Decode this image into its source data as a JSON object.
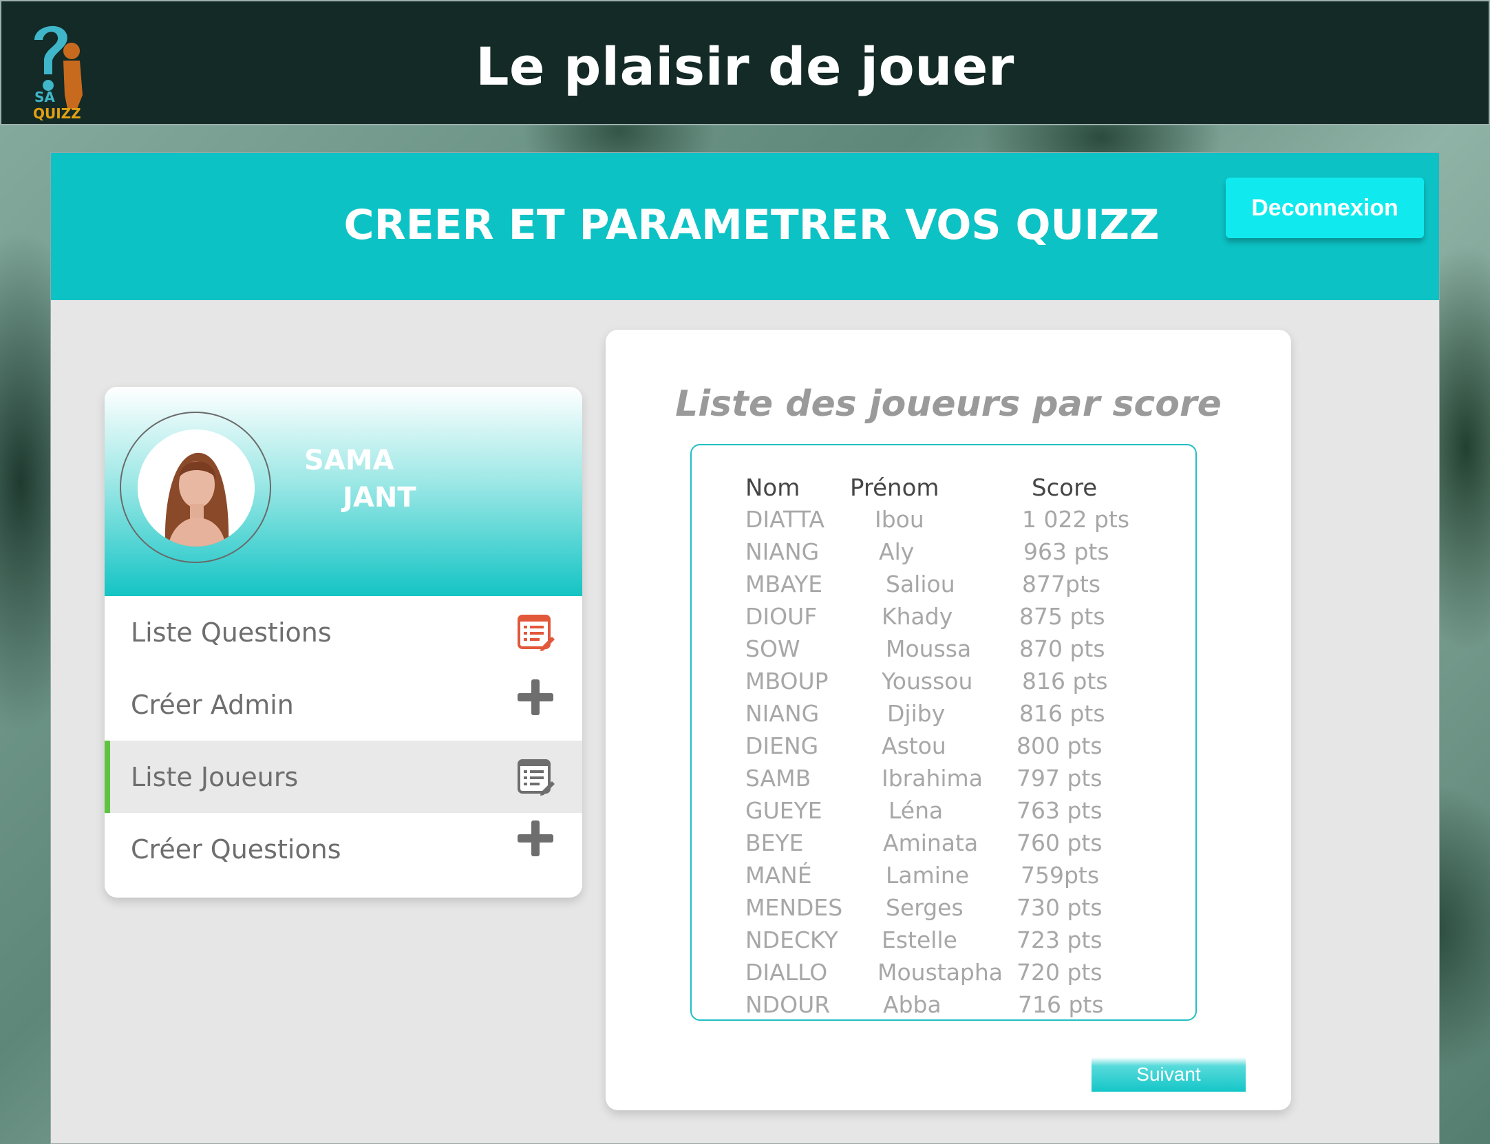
{
  "header": {
    "logo_text_top": "SA",
    "logo_text_bottom": "QUIZZ",
    "title": "Le plaisir de jouer"
  },
  "banner": {
    "title": "CREER ET PARAMETRER VOS QUIZZ",
    "logout_label": "Deconnexion"
  },
  "profile": {
    "first_name": "SAMA",
    "last_name": "JANT"
  },
  "menu": {
    "items": [
      {
        "label": "Liste Questions",
        "icon": "edit-list-icon",
        "active": false
      },
      {
        "label": "Créer Admin",
        "icon": "plus-icon",
        "active": false
      },
      {
        "label": "Liste Joueurs",
        "icon": "edit-list-icon",
        "active": true
      },
      {
        "label": "Créer Questions",
        "icon": "plus-icon",
        "active": false
      }
    ]
  },
  "scores": {
    "title": "Liste des joueurs par score",
    "columns": {
      "nom": "Nom",
      "prenom": "Prénom",
      "score": "Score"
    },
    "rows": [
      {
        "nom": "DIATTA",
        "prenom": "Ibou",
        "score": "1 022 pts"
      },
      {
        "nom": "NIANG",
        "prenom": "Aly",
        "score": "963 pts"
      },
      {
        "nom": "MBAYE",
        "prenom": "Saliou",
        "score": "877pts"
      },
      {
        "nom": "DIOUF",
        "prenom": "Khady",
        "score": "875 pts"
      },
      {
        "nom": "SOW",
        "prenom": "Moussa",
        "score": "870 pts"
      },
      {
        "nom": "MBOUP",
        "prenom": "Youssou",
        "score": "816 pts"
      },
      {
        "nom": "NIANG",
        "prenom": "Djiby",
        "score": "816 pts"
      },
      {
        "nom": "DIENG",
        "prenom": "Astou",
        "score": "800 pts"
      },
      {
        "nom": "SAMB",
        "prenom": "Ibrahima",
        "score": "797 pts"
      },
      {
        "nom": "GUEYE",
        "prenom": "Léna",
        "score": "763 pts"
      },
      {
        "nom": "BEYE",
        "prenom": "Aminata",
        "score": "760 pts"
      },
      {
        "nom": "MANÉ",
        "prenom": "Lamine",
        "score": "759pts"
      },
      {
        "nom": "MENDES",
        "prenom": "Serges",
        "score": "730 pts"
      },
      {
        "nom": "NDECKY",
        "prenom": "Estelle",
        "score": "723 pts"
      },
      {
        "nom": "DIALLO",
        "prenom": "Moustapha",
        "score": "720 pts"
      },
      {
        "nom": "NDOUR",
        "prenom": "Abba",
        "score": "716 pts"
      }
    ],
    "next_label": "Suivant"
  },
  "colors": {
    "topbar": "#132a26",
    "accent": "#0cc2c5",
    "active_indicator": "#5ec440"
  }
}
